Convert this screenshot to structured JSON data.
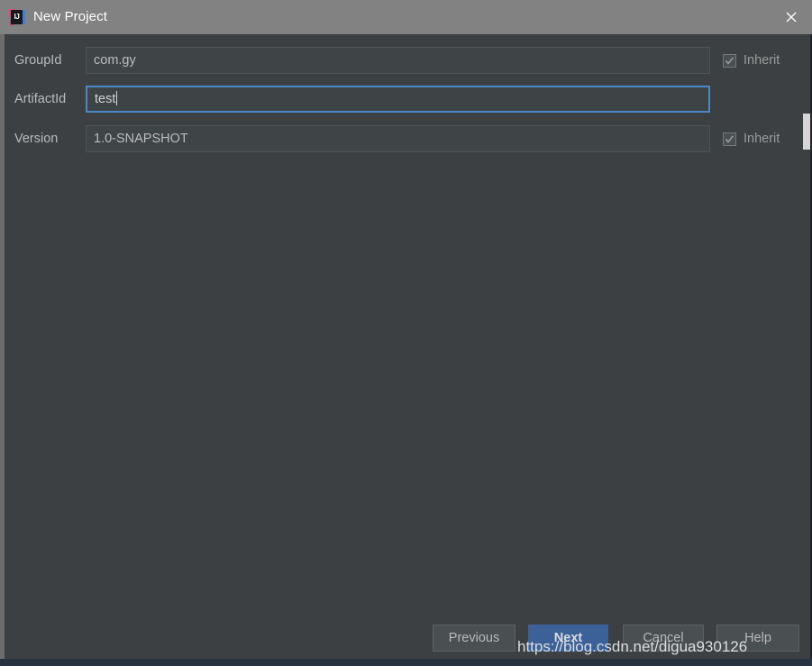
{
  "window": {
    "title": "New Project",
    "app_icon": "intellij-idea-icon",
    "icon_text": "IJ",
    "close_icon": "close-icon"
  },
  "form": {
    "fields": [
      {
        "label": "GroupId",
        "value": "com.gy",
        "focused": false,
        "inherit_label": "Inherit",
        "inherit_checked": true
      },
      {
        "label": "ArtifactId",
        "value": "test",
        "focused": true,
        "inherit_label": "",
        "inherit_checked": false
      },
      {
        "label": "Version",
        "value": "1.0-SNAPSHOT",
        "focused": false,
        "inherit_label": "Inherit",
        "inherit_checked": true
      }
    ]
  },
  "buttons": {
    "previous": "Previous",
    "next": "Next",
    "cancel": "Cancel",
    "help": "Help"
  },
  "watermark": {
    "text": "https://blog.csdn.net/digua930126"
  },
  "colors": {
    "titlebar": "#828282",
    "dialog_bg": "#3c4043",
    "field_bg": "#3f4447",
    "focus_border": "#4a88c7",
    "primary_button": "#3c6098",
    "button_bg": "#4a4f52",
    "label_text": "#bbbbbb",
    "bottom_strip": "#273340"
  },
  "scrollbar": {
    "visible": true,
    "thumb_color": "#d6d6d6"
  }
}
